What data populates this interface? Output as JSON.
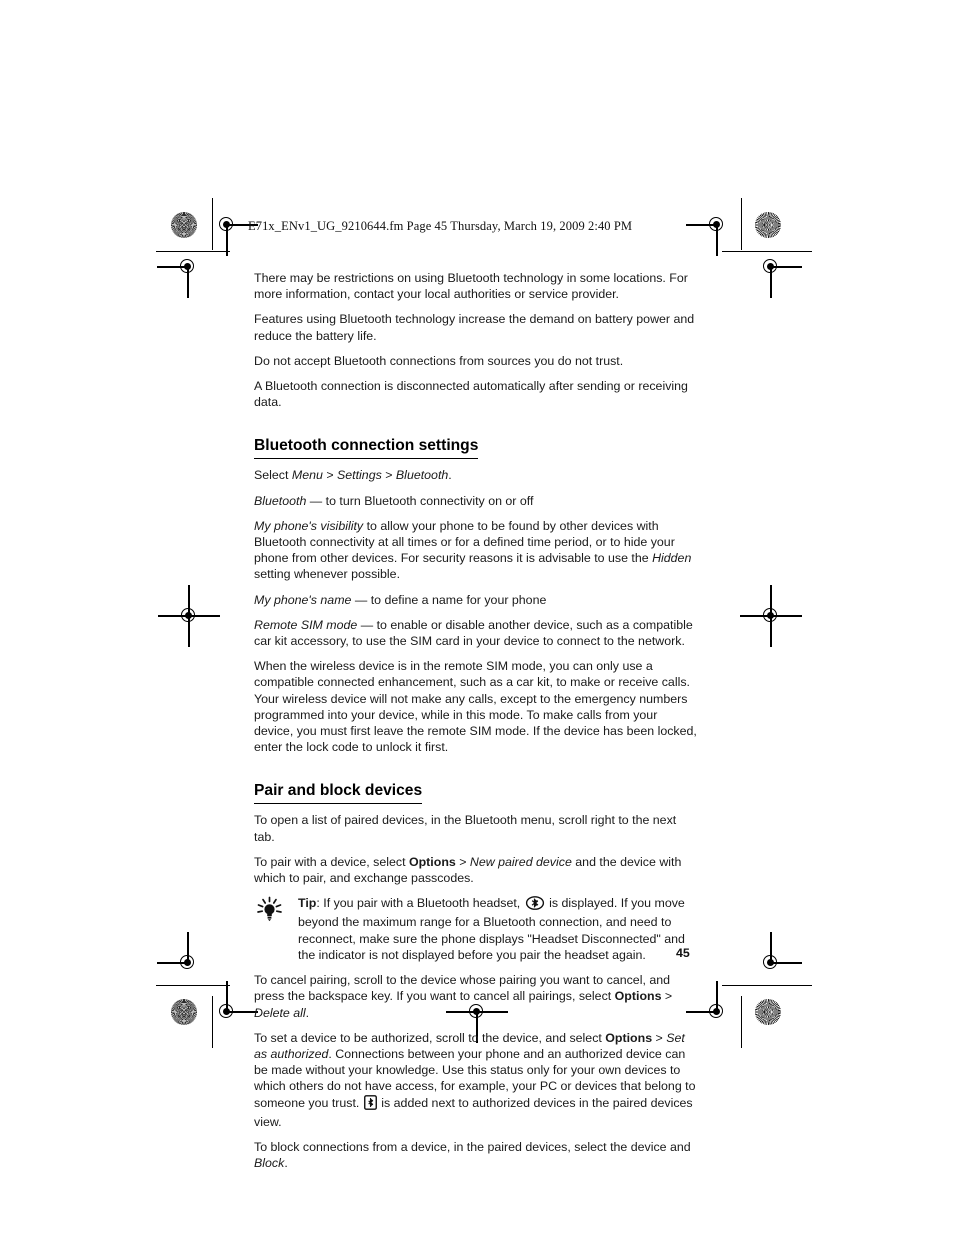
{
  "document": {
    "running_header": "E71x_ENv1_UG_9210644.fm  Page 45  Thursday, March 19, 2009  2:40 PM",
    "folio": "45"
  },
  "body": {
    "intro": [
      "There may be restrictions on using Bluetooth technology in some locations. For more information, contact your local authorities or service provider.",
      "Features using Bluetooth technology increase the demand on battery power and reduce the battery life.",
      "Do not accept Bluetooth connections from sources you do not trust.",
      "A Bluetooth connection is disconnected automatically after sending or receiving data."
    ]
  },
  "sections": [
    {
      "id": "bluetooth-connection-settings",
      "heading": "Bluetooth connection settings",
      "select_path": {
        "lead": "Select ",
        "item1": "Menu",
        "sep1": " > ",
        "item2": "Settings",
        "sep2": " > ",
        "item3": "Bluetooth",
        "end": "."
      },
      "settings": [
        {
          "term": "Bluetooth",
          "dash": " — ",
          "definition": "to turn Bluetooth connectivity on or off"
        },
        {
          "term": "My phone's visibility",
          "dash": " ",
          "definition_part1": "to allow your phone to be found by other devices with Bluetooth connectivity at all times or for a defined time period, or to hide your phone from other devices. For security reasons it is advisable to use the ",
          "emphasis": "Hidden",
          "definition_part2": " setting whenever possible."
        },
        {
          "term": "My phone's name",
          "dash": " — ",
          "definition": "to define a name for your phone"
        },
        {
          "term": "Remote SIM mode",
          "dash": " — ",
          "definition": "to enable or disable another device, such as a compatible car kit accessory, to use the SIM card in your device to connect to the network."
        }
      ],
      "note": "When the wireless device is in the remote SIM mode, you can only use a compatible connected enhancement, such as a car kit, to make or receive calls. Your wireless device will not make any calls, except to the emergency numbers programmed into your device, while in this mode. To make calls from your device, you must first leave the remote SIM mode. If the device has been locked, enter the lock code to unlock it first."
    },
    {
      "id": "pair-and-block-devices",
      "heading": "Pair and block devices",
      "paragraph_open_list": "To open a list of paired devices, in the Bluetooth menu, scroll right to the next tab.",
      "paragraph_pair": {
        "part1": "To pair with a device, select ",
        "bold1": "Options",
        "part2": " > ",
        "italic1": "New paired device",
        "part3": " and the device with which to pair, and exchange passcodes."
      },
      "tip": {
        "label": "Tip",
        "colon": ": ",
        "part1": "If you pair with a Bluetooth headset, ",
        "icon": "bluetooth-headset-indicator-icon",
        "part2": " is displayed. If you move beyond the maximum range for a Bluetooth connection, and need to reconnect, make sure the phone displays \"Headset Disconnected\" and the indicator is not displayed before you pair the headset again."
      },
      "paragraph_cancel": {
        "part1": "To cancel pairing, scroll to the device whose pairing you want to cancel, and press the backspace key. If you want to cancel all pairings, select ",
        "bold1": "Options",
        "part2": " > ",
        "italic1": "Delete all",
        "part3": "."
      },
      "paragraph_authorize": {
        "part1": "To set a device to be authorized, scroll to the device, and select ",
        "bold1": "Options",
        "part2": " > ",
        "italic1": "Set as authorized",
        "part3": ". Connections between your phone and an authorized device can be made without your knowledge. Use this status only for your own devices to which others do not have access, for example, your PC or devices that belong to someone you trust. ",
        "icon": "authorized-device-indicator-icon",
        "part4": " is added next to authorized devices in the paired devices view."
      },
      "paragraph_block": {
        "part1": "To block connections from a device, in the paired devices, select the device and ",
        "italic1": "Block",
        "part2": "."
      }
    }
  ],
  "prepress": {
    "ink_color": "#000000",
    "page_background": "#ffffff"
  }
}
